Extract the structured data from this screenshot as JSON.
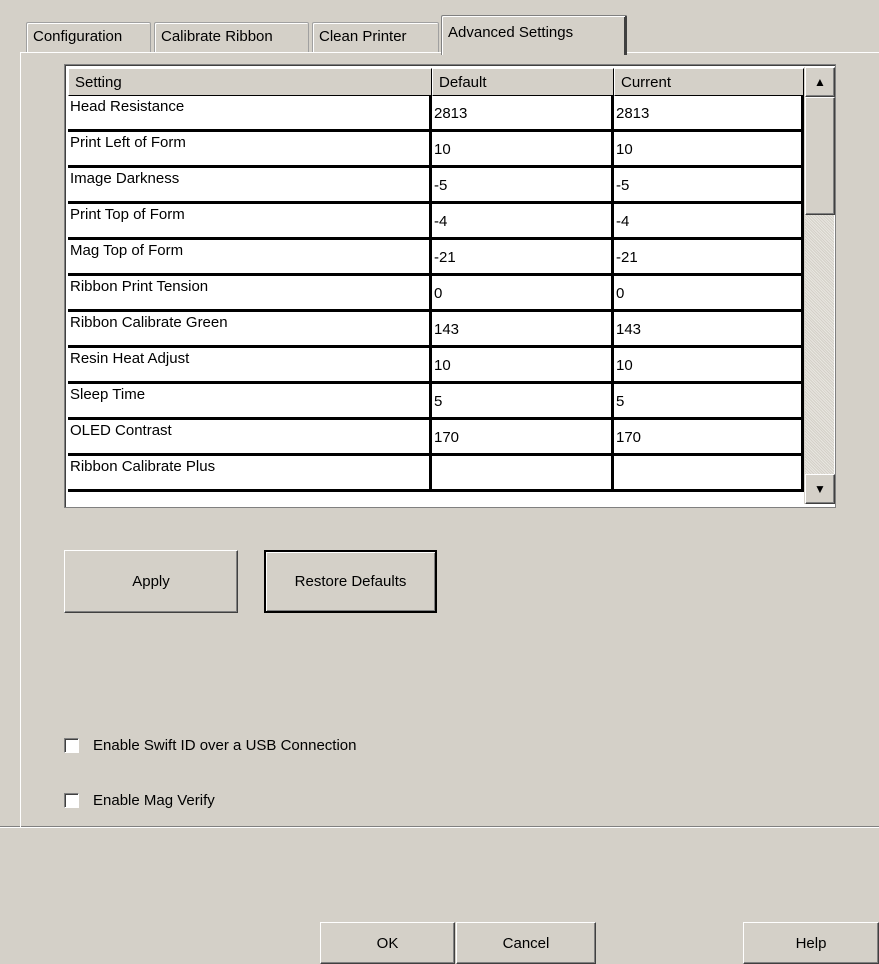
{
  "tabs": [
    {
      "label": "Configuration"
    },
    {
      "label": "Calibrate Ribbon"
    },
    {
      "label": "Clean Printer"
    },
    {
      "label": "Advanced Settings"
    }
  ],
  "grid": {
    "columns": [
      "Setting",
      "Default",
      "Current"
    ],
    "rows": [
      [
        "Head Resistance",
        "2813",
        "2813"
      ],
      [
        "Print Left of Form",
        "10",
        "10"
      ],
      [
        "Image Darkness",
        "-5",
        "-5"
      ],
      [
        "Print Top of Form",
        "-4",
        "-4"
      ],
      [
        "Mag Top of Form",
        "-21",
        "-21"
      ],
      [
        "Ribbon Print Tension",
        "0",
        "0"
      ],
      [
        "Ribbon Calibrate Green",
        "143",
        "143"
      ],
      [
        "Resin Heat Adjust",
        "10",
        "10"
      ],
      [
        "Sleep Time",
        "5",
        "5"
      ],
      [
        "OLED Contrast",
        "170",
        "170"
      ],
      [
        "Ribbon Calibrate Plus",
        "",
        ""
      ]
    ]
  },
  "buttons": {
    "apply": "Apply",
    "restore_defaults": "Restore Defaults",
    "ok": "OK",
    "cancel": "Cancel",
    "help": "Help"
  },
  "checkboxes": {
    "swift_id": {
      "label": "Enable Swift ID over a USB Connection",
      "checked": false
    },
    "mag_verify": {
      "label": "Enable Mag Verify",
      "checked": false
    }
  },
  "scroll_icons": {
    "up": "up-arrow-icon",
    "down": "down-arrow-icon"
  }
}
